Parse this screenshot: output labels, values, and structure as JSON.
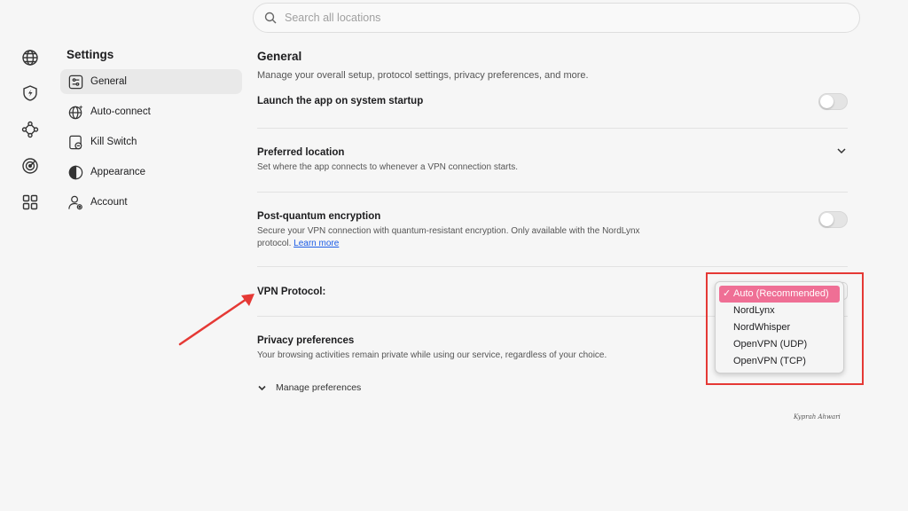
{
  "search": {
    "placeholder": "Search all locations"
  },
  "rail": {
    "icons": [
      "globe-icon",
      "shield-bolt-icon",
      "meshnet-icon",
      "target-icon",
      "grid-icon"
    ]
  },
  "sidebar": {
    "title": "Settings",
    "items": [
      {
        "label": "General",
        "icon": "sliders-icon",
        "active": true
      },
      {
        "label": "Auto-connect",
        "icon": "globe-sparkle-icon",
        "active": false
      },
      {
        "label": "Kill Switch",
        "icon": "kill-switch-icon",
        "active": false
      },
      {
        "label": "Appearance",
        "icon": "half-circle-icon",
        "active": false
      },
      {
        "label": "Account",
        "icon": "user-gear-icon",
        "active": false
      }
    ]
  },
  "main": {
    "title": "General",
    "subtitle": "Manage your overall setup, protocol settings, privacy preferences, and more.",
    "launch": {
      "title": "Launch the app on system startup",
      "on": false
    },
    "preferred": {
      "title": "Preferred location",
      "desc": "Set where the app connects to whenever a VPN connection starts."
    },
    "pq": {
      "title": "Post-quantum encryption",
      "desc": "Secure your VPN connection with quantum-resistant encryption. Only available with the NordLynx protocol.",
      "desc_line1": "Secure your VPN connection with quantum-resistant encryption. Only available with the NordLynx",
      "desc_line2": "protocol.",
      "link": "Learn more",
      "on": false
    },
    "protocol": {
      "label": "VPN Protocol:",
      "selected": "Auto (Recommended)",
      "options": [
        "Auto (Recommended)",
        "NordLynx",
        "NordWhisper",
        "OpenVPN (UDP)",
        "OpenVPN (TCP)"
      ]
    },
    "privacy": {
      "title": "Privacy preferences",
      "desc": "Your browsing activities remain private while using our service, regardless of your choice.",
      "manage": "Manage preferences"
    }
  },
  "annotation": {
    "color": "#e53935"
  },
  "colors": {
    "selection": "#ef6f95",
    "link": "#1a5ce6",
    "background": "#f6f6f6"
  },
  "signature": "Kyprah Ahwari"
}
